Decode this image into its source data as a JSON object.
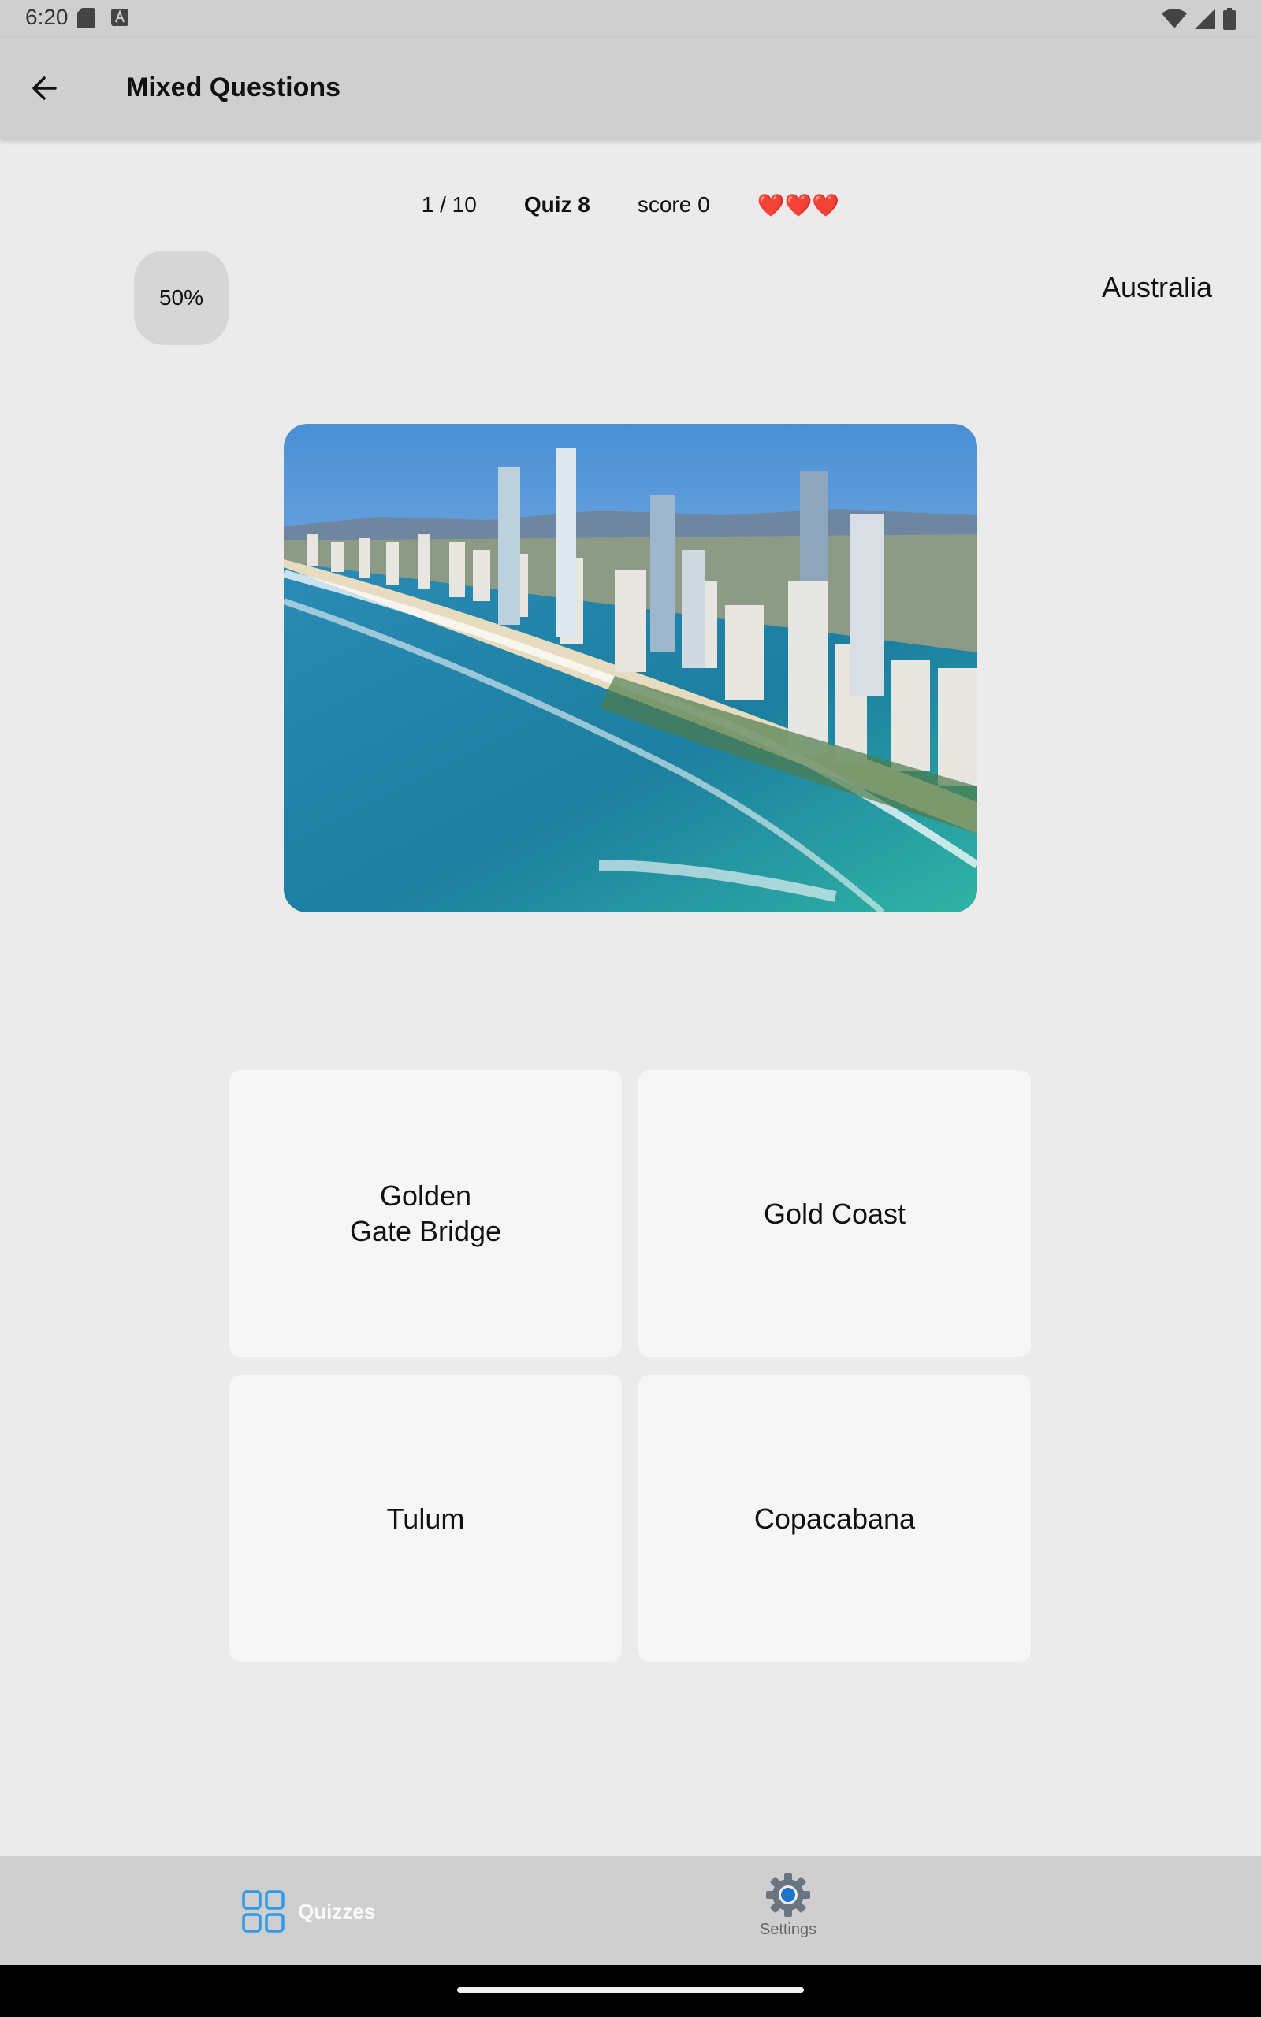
{
  "status_bar": {
    "time": "6:20",
    "icons": [
      "sd-card-icon",
      "keyboard-a-icon",
      "wifi-icon",
      "signal-icon",
      "battery-icon"
    ]
  },
  "app_bar": {
    "title": "Mixed Questions",
    "back_icon": "arrow-left-icon"
  },
  "quiz_info": {
    "progress": "1 / 10",
    "quiz_name": "Quiz 8",
    "score": "score 0",
    "lives": "❤️❤️❤️"
  },
  "lifeline": {
    "label": "50%"
  },
  "country": "Australia",
  "question_image": {
    "description_icon": "coastal-city-photo"
  },
  "answers": [
    {
      "label": "Golden\nGate Bridge"
    },
    {
      "label": "Gold Coast"
    },
    {
      "label": "Tulum"
    },
    {
      "label": "Copacabana"
    }
  ],
  "bottom_nav": {
    "quizzes_label": "Quizzes",
    "settings_label": "Settings",
    "active_color": "#2f9be8",
    "inactive_color": "#6b7580"
  }
}
